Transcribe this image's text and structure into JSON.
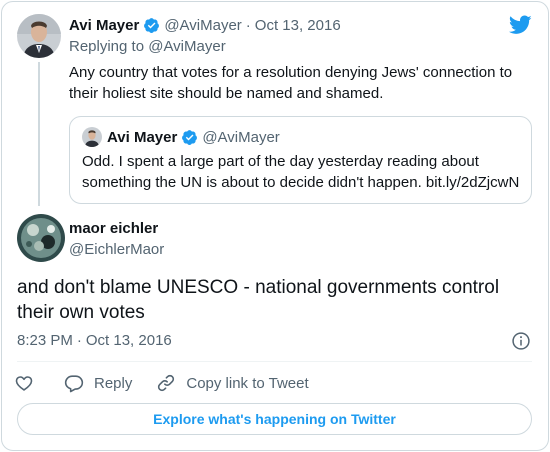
{
  "colors": {
    "accent": "#1d9bf0",
    "text_primary": "#0f1419",
    "text_secondary": "#536471",
    "border": "#cfd9de"
  },
  "logo": {
    "icon": "twitter-bird-icon"
  },
  "parent_tweet": {
    "author_name": "Avi Mayer",
    "verified_icon": "verified-badge-icon",
    "handle": "@AviMayer",
    "separator": "·",
    "date": "Oct 13, 2016",
    "replying_prefix": "Replying to",
    "replying_handle": "@AviMayer",
    "text": "Any country that votes for a resolution denying Jews' connection to their holiest site should be named and shamed.",
    "quoted": {
      "author_name": "Avi Mayer",
      "handle": "@AviMayer",
      "text": "Odd. I spent a large part of the day yesterday reading about something the UN is about to decide didn't happen. bit.ly/2dZjcwN"
    }
  },
  "main_tweet": {
    "author_name": "maor eichler",
    "handle": "@EichlerMaor",
    "text": "and don't blame UNESCO - national governments  control their own votes",
    "time": "8:23 PM",
    "separator": "·",
    "date": "Oct 13, 2016"
  },
  "actions": {
    "like_icon": "heart-icon",
    "reply_icon": "reply-bubble-icon",
    "reply_label": "Reply",
    "copy_icon": "link-icon",
    "copy_label": "Copy link to Tweet"
  },
  "footer": {
    "explore_label": "Explore what's happening on Twitter"
  }
}
